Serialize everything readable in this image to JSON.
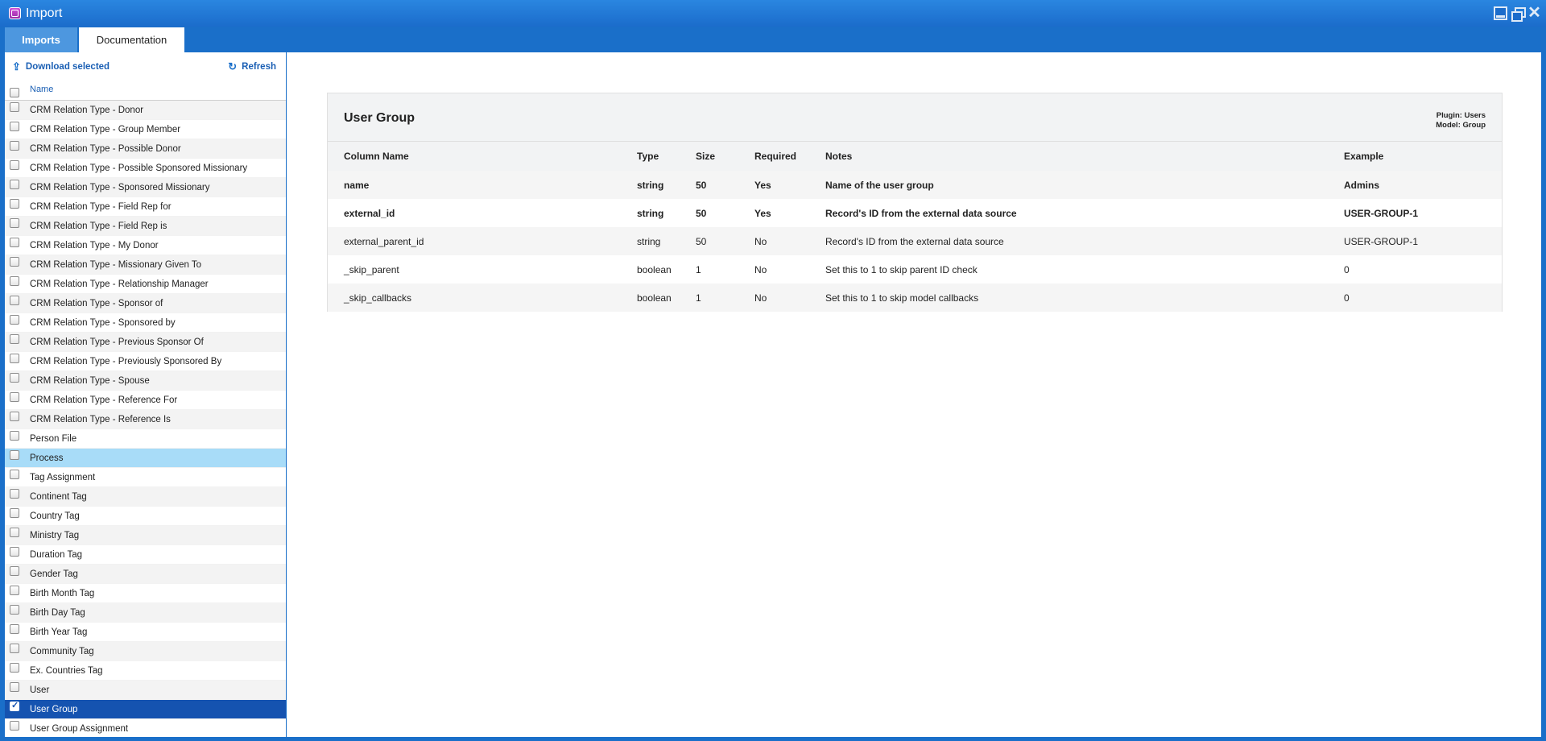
{
  "window": {
    "title": "Import"
  },
  "tabs": [
    {
      "label": "Imports"
    },
    {
      "label": "Documentation"
    }
  ],
  "left_toolbar": {
    "download_label": "Download selected",
    "refresh_label": "Refresh"
  },
  "list": {
    "header": "Name",
    "items": [
      {
        "label": "CRM Relation Type - Donor",
        "state": "alt"
      },
      {
        "label": "CRM Relation Type - Group Member",
        "state": ""
      },
      {
        "label": "CRM Relation Type - Possible Donor",
        "state": "alt"
      },
      {
        "label": "CRM Relation Type - Possible Sponsored Missionary",
        "state": ""
      },
      {
        "label": "CRM Relation Type - Sponsored Missionary",
        "state": "alt"
      },
      {
        "label": "CRM Relation Type - Field Rep for",
        "state": ""
      },
      {
        "label": "CRM Relation Type - Field Rep is",
        "state": "alt"
      },
      {
        "label": "CRM Relation Type - My Donor",
        "state": ""
      },
      {
        "label": "CRM Relation Type - Missionary Given To",
        "state": "alt"
      },
      {
        "label": "CRM Relation Type - Relationship Manager",
        "state": ""
      },
      {
        "label": "CRM Relation Type - Sponsor of",
        "state": "alt"
      },
      {
        "label": "CRM Relation Type - Sponsored by",
        "state": ""
      },
      {
        "label": "CRM Relation Type - Previous Sponsor Of",
        "state": "alt"
      },
      {
        "label": "CRM Relation Type - Previously Sponsored By",
        "state": ""
      },
      {
        "label": "CRM Relation Type - Spouse",
        "state": "alt"
      },
      {
        "label": "CRM Relation Type - Reference For",
        "state": ""
      },
      {
        "label": "CRM Relation Type - Reference Is",
        "state": "alt"
      },
      {
        "label": "Person File",
        "state": ""
      },
      {
        "label": "Process",
        "state": "hl"
      },
      {
        "label": "Tag Assignment",
        "state": ""
      },
      {
        "label": "Continent Tag",
        "state": "alt"
      },
      {
        "label": "Country Tag",
        "state": ""
      },
      {
        "label": "Ministry Tag",
        "state": "alt"
      },
      {
        "label": "Duration Tag",
        "state": ""
      },
      {
        "label": "Gender Tag",
        "state": "alt"
      },
      {
        "label": "Birth Month Tag",
        "state": ""
      },
      {
        "label": "Birth Day Tag",
        "state": "alt"
      },
      {
        "label": "Birth Year Tag",
        "state": ""
      },
      {
        "label": "Community Tag",
        "state": "alt"
      },
      {
        "label": "Ex. Countries Tag",
        "state": ""
      },
      {
        "label": "User",
        "state": "alt"
      },
      {
        "label": "User Group",
        "state": "sel"
      },
      {
        "label": "User Group Assignment",
        "state": ""
      }
    ]
  },
  "doc": {
    "title": "User Group",
    "plugin": "Plugin: Users",
    "model": "Model: Group",
    "columns": [
      "Column Name",
      "Type",
      "Size",
      "Required",
      "Notes",
      "Example"
    ],
    "rows": [
      {
        "name": "name",
        "type": "string",
        "size": "50",
        "required": "Yes",
        "notes": "Name of the user group",
        "example": "Admins"
      },
      {
        "name": "external_id",
        "type": "string",
        "size": "50",
        "required": "Yes",
        "notes": "Record's ID from the external data source",
        "example": "USER-GROUP-1"
      },
      {
        "name": "external_parent_id",
        "type": "string",
        "size": "50",
        "required": "No",
        "notes": "Record's ID from the external data source",
        "example": "USER-GROUP-1"
      },
      {
        "name": "_skip_parent",
        "type": "boolean",
        "size": "1",
        "required": "No",
        "notes": "Set this to 1 to skip parent ID check",
        "example": "0"
      },
      {
        "name": "_skip_callbacks",
        "type": "boolean",
        "size": "1",
        "required": "No",
        "notes": "Set this to 1 to skip model callbacks",
        "example": "0"
      }
    ]
  }
}
